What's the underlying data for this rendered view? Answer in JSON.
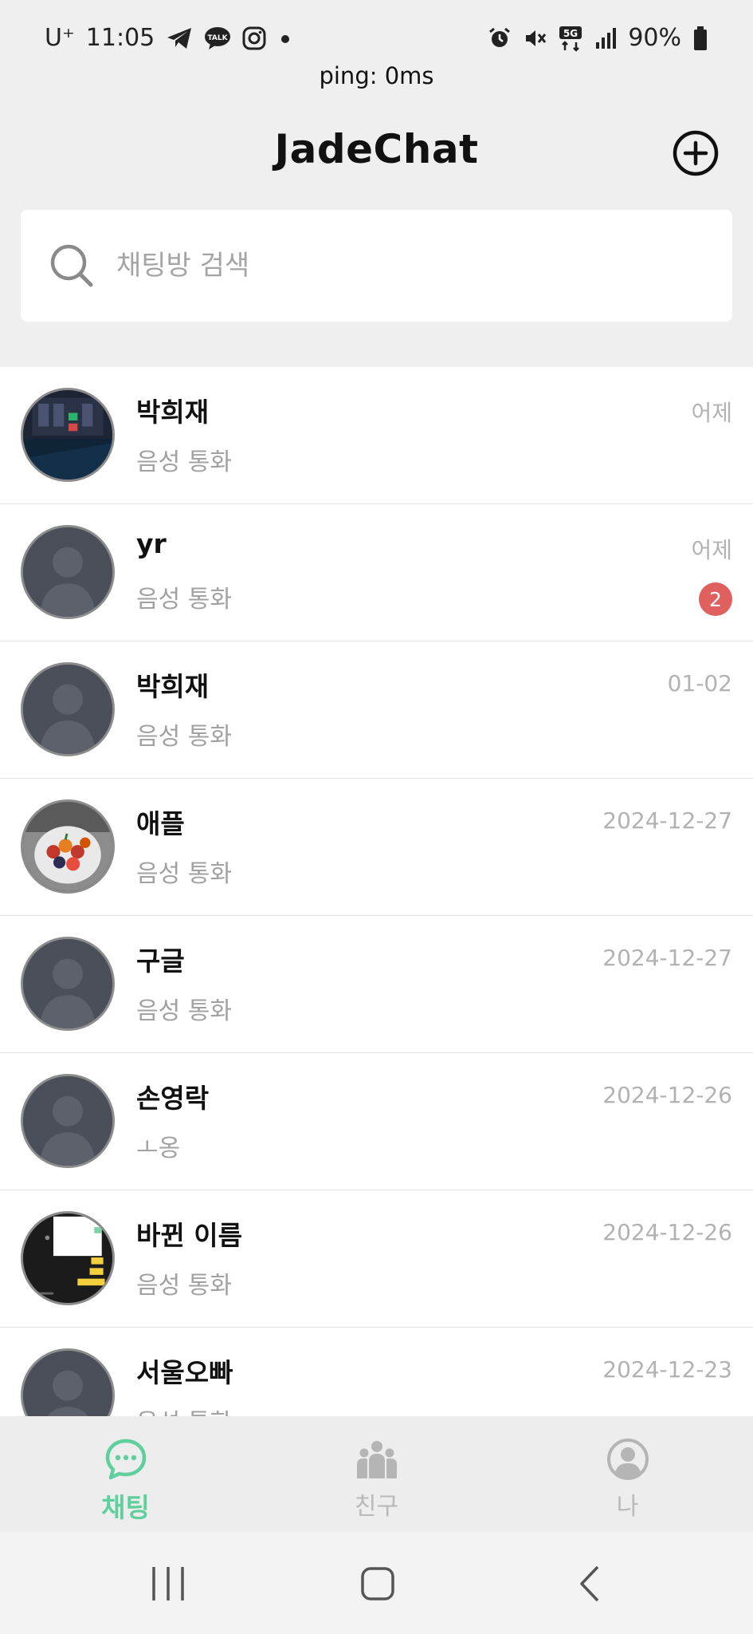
{
  "status_bar": {
    "carrier": "U⁺",
    "time": "11:05",
    "battery": "90%",
    "network": "5G",
    "ping": "ping: 0ms"
  },
  "header": {
    "title": "JadeChat",
    "add_icon": "plus-circle-icon"
  },
  "search": {
    "placeholder": "채팅방 검색",
    "icon": "search-icon"
  },
  "chats": [
    {
      "name": "박희재",
      "preview": "음성 통화",
      "time": "어제",
      "unread": "",
      "avatar": "photo-screen"
    },
    {
      "name": "yr",
      "preview": "음성 통화",
      "time": "어제",
      "unread": "2",
      "avatar": "default"
    },
    {
      "name": "박희재",
      "preview": "음성 통화",
      "time": "01-02",
      "unread": "",
      "avatar": "default"
    },
    {
      "name": "애플",
      "preview": "음성 통화",
      "time": "2024-12-27",
      "unread": "",
      "avatar": "photo-fruit"
    },
    {
      "name": "구글",
      "preview": "음성 통화",
      "time": "2024-12-27",
      "unread": "",
      "avatar": "default"
    },
    {
      "name": "손영락",
      "preview": "ㅗ옹",
      "time": "2024-12-26",
      "unread": "",
      "avatar": "default"
    },
    {
      "name": "바뀐 이름",
      "preview": "음성 통화",
      "time": "2024-12-26",
      "unread": "",
      "avatar": "photo-chat"
    },
    {
      "name": "서울오빠",
      "preview": "음성 통화",
      "time": "2024-12-23",
      "unread": "",
      "avatar": "default"
    }
  ],
  "bottom_nav": {
    "tabs": [
      {
        "label": "채팅",
        "icon": "chat-bubble-icon",
        "active": true
      },
      {
        "label": "친구",
        "icon": "friends-icon",
        "active": false
      },
      {
        "label": "나",
        "icon": "profile-icon",
        "active": false
      }
    ]
  },
  "colors": {
    "accent": "#5fcf9c",
    "badge": "#e0605f",
    "avatar_bg": "#4b4f5a"
  }
}
